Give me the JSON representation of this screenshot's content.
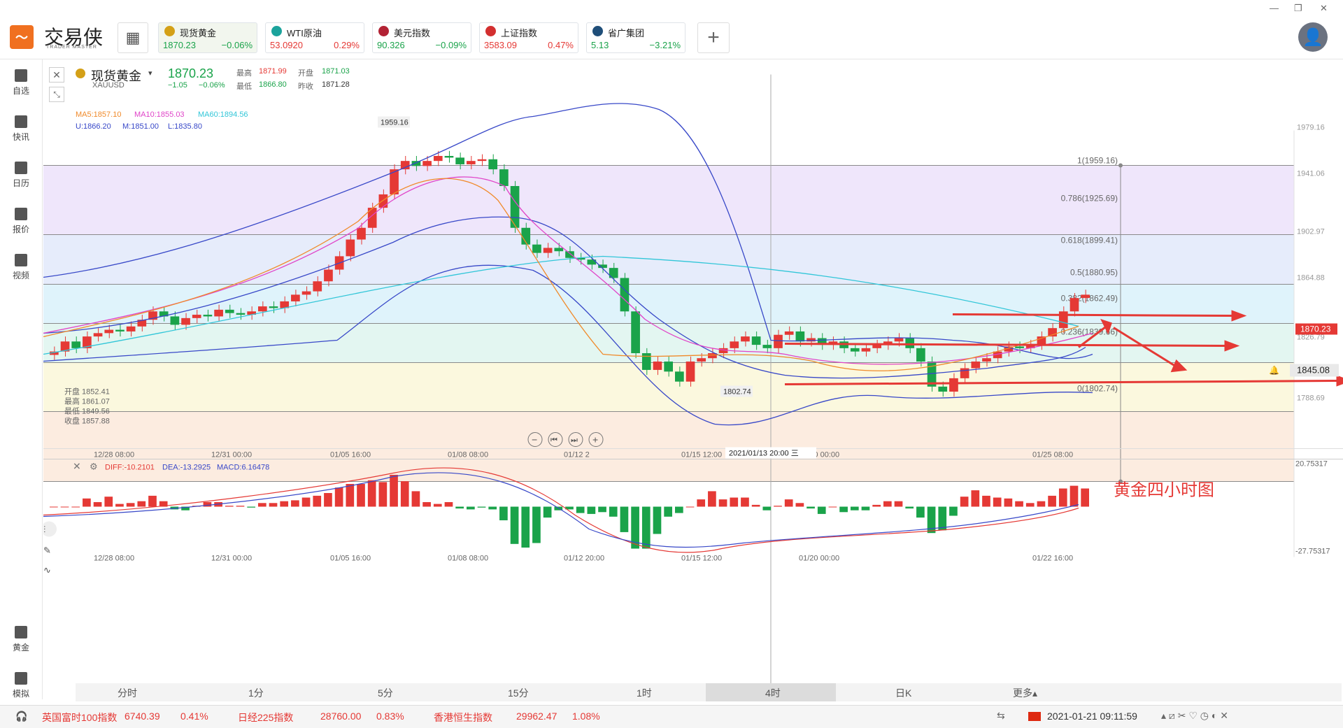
{
  "app": {
    "brand": "交易侠",
    "brand_sub": "TRADER MASTER"
  },
  "quotes": [
    {
      "name": "现货黄金",
      "price": "1870.23",
      "change": "−0.06%",
      "color": "#1aa34a",
      "icon_color": "#d4a017",
      "active": true
    },
    {
      "name": "WTI原油",
      "price": "53.0920",
      "change": "0.29%",
      "color": "#e53935",
      "icon_color": "#1ba39c",
      "active": false
    },
    {
      "name": "美元指数",
      "price": "90.326",
      "change": "−0.09%",
      "color": "#1aa34a",
      "icon_color": "#b22234",
      "active": false
    },
    {
      "name": "上证指数",
      "price": "3583.09",
      "change": "0.47%",
      "color": "#e53935",
      "icon_color": "#d32f2f",
      "active": false
    },
    {
      "name": "省广集团",
      "price": "5.13",
      "change": "−3.21%",
      "color": "#1aa34a",
      "icon_color": "#1f4e79",
      "active": false
    }
  ],
  "sidebar": [
    {
      "label": "自选",
      "icon": "bookmark-icon"
    },
    {
      "label": "快讯",
      "icon": "news-icon"
    },
    {
      "label": "日历",
      "icon": "calendar-icon"
    },
    {
      "label": "报价",
      "icon": "quote-chart-icon"
    },
    {
      "label": "视频",
      "icon": "video-icon"
    }
  ],
  "sidebar_bottom": [
    {
      "label": "黄金",
      "icon": "gold-icon"
    },
    {
      "label": "模拟",
      "icon": "simulate-icon"
    }
  ],
  "instrument": {
    "name": "现货黄金",
    "symbol": "XAUUSD",
    "price": "1870.23",
    "change": "−1.05",
    "change_pct": "−0.06%",
    "high_label": "最高",
    "high": "1871.99",
    "open_label": "开盘",
    "open": "1871.03",
    "low_label": "最低",
    "low": "1866.80",
    "prev_label": "昨收",
    "prev": "1871.28"
  },
  "indicators": {
    "ma5": "MA5:1857.10",
    "ma10": "MA10:1855.03",
    "ma60": "MA60:1894.56",
    "u": "U:1866.20",
    "m": "M:1851.00",
    "l": "L:1835.80"
  },
  "ohlc_box": {
    "open": "开盘 1852.41",
    "high": "最高 1861.07",
    "low": "最低 1849.56",
    "close": "收盘 1857.88"
  },
  "price_axis": [
    "1979.16",
    "1941.06",
    "1902.97",
    "1864.88",
    "1826.79",
    "1788.69"
  ],
  "price_tags": {
    "current": "1870.23",
    "alert": "1845.08"
  },
  "fib_levels": [
    "1(1959.16)",
    "0.786(1925.69)",
    "0.618(1899.41)",
    "0.5(1880.95)",
    "0.382(1862.49)",
    "0.236(1839.66)",
    "0(1802.74)"
  ],
  "extremes": {
    "max": "1959.16",
    "min": "1802.74"
  },
  "time_axis": [
    "12/28 08:00",
    "12/31 00:00",
    "01/05 16:00",
    "01/08 08:00",
    "01/12 2",
    "01/15 12:00",
    "01/20 00:00",
    "01/25 08:00"
  ],
  "crosshair_time": "2021/01/13 20:00 三",
  "annotation": "黄金四小时图",
  "macd": {
    "diff": "DIFF:-10.2101",
    "dea": "DEA:-13.2925",
    "macd": "MACD:6.16478",
    "top": "20.75317",
    "bottom": "-27.75317"
  },
  "macd_time_axis": [
    "12/28 08:00",
    "12/31 00:00",
    "01/05 16:00",
    "01/08 08:00",
    "01/12 20:00",
    "01/15 12:00",
    "01/20 00:00",
    "01/22 16:00"
  ],
  "periods": [
    "分时",
    "1分",
    "5分",
    "15分",
    "1时",
    "4时",
    "日K",
    "更多▴"
  ],
  "active_period": "4时",
  "ticker": [
    {
      "name": "英国富时100指数",
      "price": "6740.39",
      "pct": "0.41%"
    },
    {
      "name": "日经225指数",
      "price": "28760.00",
      "pct": "0.83%"
    },
    {
      "name": "香港恒生指数",
      "price": "29962.47",
      "pct": "1.08%"
    }
  ],
  "clock": "2021-01-21 09:11:59",
  "colors": {
    "up": "#e53935",
    "down": "#1aa34a",
    "accent": "#f07020"
  },
  "chart_data": {
    "type": "candlestick",
    "title": "现货黄金 XAUUSD 4H",
    "ylim": [
      1780,
      1985
    ],
    "fib": {
      "high": 1959.16,
      "low": 1802.74
    },
    "close_series": [
      1836,
      1842,
      1838,
      1845,
      1847,
      1849,
      1848,
      1851,
      1855,
      1860,
      1857,
      1852,
      1856,
      1858,
      1857,
      1861,
      1859,
      1858,
      1860,
      1863,
      1862,
      1866,
      1870,
      1872,
      1878,
      1885,
      1893,
      1903,
      1910,
      1922,
      1930,
      1945,
      1950,
      1947,
      1950,
      1953,
      1952,
      1948,
      1950,
      1951,
      1945,
      1935,
      1910,
      1900,
      1895,
      1898,
      1896,
      1892,
      1891,
      1888,
      1886,
      1880,
      1860,
      1835,
      1825,
      1830,
      1824,
      1818,
      1830,
      1832,
      1835,
      1838,
      1842,
      1845,
      1840,
      1838,
      1846,
      1848,
      1842,
      1844,
      1840,
      1842,
      1838,
      1836,
      1838,
      1840,
      1842,
      1844,
      1838,
      1830,
      1815,
      1812,
      1820,
      1826,
      1830,
      1832,
      1836,
      1839,
      1838,
      1840,
      1845,
      1850,
      1860,
      1868,
      1870
    ]
  }
}
